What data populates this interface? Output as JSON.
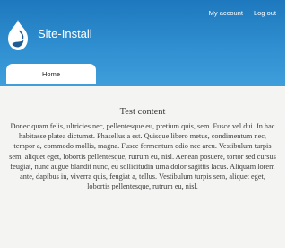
{
  "header": {
    "site_name": "Site-Install",
    "secondary_menu": [
      "My account",
      "Log out"
    ],
    "colors": {
      "top": "#1e78bd",
      "bottom": "#3f9edb",
      "text": "#ffffff"
    },
    "logo_icon": "drupal-drop-icon"
  },
  "main_menu": {
    "tabs": [
      {
        "label": "Home",
        "active": true
      }
    ]
  },
  "content": {
    "title": "Test content",
    "body": "Donec quam felis, ultricies nec, pellentesque eu, pretium quis, sem. Fusce vel dui. In hac habitasse platea dictumst. Phasellus a est. Quisque libero metus, condimentum nec, tempor a, commodo mollis, magna. Fusce fermentum odio nec arcu. Vestibulum turpis sem, aliquet eget, lobortis pellentesque, rutrum eu, nisl. Aenean posuere, tortor sed cursus feugiat, nunc augue blandit nunc, eu sollicitudin urna dolor sagittis lacus. Aliquam lorem ante, dapibus in, viverra quis, feugiat a, tellus. Vestibulum turpis sem, aliquet eget, lobortis pellentesque, rutrum eu, nisl."
  }
}
